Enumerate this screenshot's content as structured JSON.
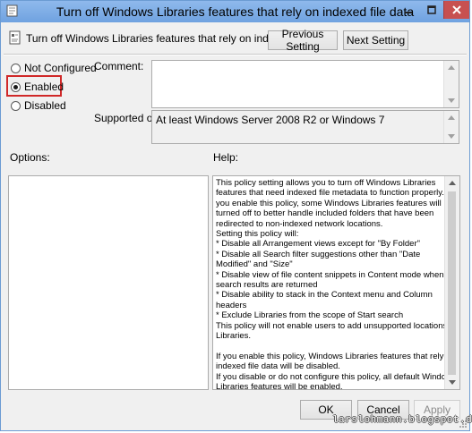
{
  "window": {
    "title": "Turn off Windows Libraries features that rely on indexed file data",
    "header_text": "Turn off Windows Libraries features that rely on indexed file data",
    "accent_title_bar": "#7aaae6",
    "accent_close_button": "#c75050"
  },
  "navigation": {
    "previous_label": "Previous Setting",
    "next_label": "Next Setting"
  },
  "state_options": {
    "not_configured": "Not Configured",
    "enabled": "Enabled",
    "disabled": "Disabled",
    "selected": "Enabled",
    "highlight_color": "#d02828"
  },
  "fields": {
    "comment_label": "Comment:",
    "comment_value": "",
    "supported_label": "Supported on:",
    "supported_value": "At least Windows Server 2008 R2 or Windows 7"
  },
  "panels": {
    "options_label": "Options:",
    "help_label": "Help:",
    "help_lines": [
      "This policy setting allows you to turn off Windows Libraries",
      "features that need indexed file metadata to function properly.  If",
      "you enable this policy, some Windows Libraries features will be",
      "turned off to better handle included folders that have been",
      "redirected to non-indexed network locations.",
      "Setting this policy will:",
      "    * Disable all Arrangement views except for \"By Folder\"",
      "    * Disable all Search filter suggestions other than \"Date",
      "Modified\" and \"Size\"",
      "    * Disable view of file content snippets in Content mode when",
      "search results are returned",
      "    * Disable ability to stack in the Context menu and Column",
      "headers",
      "    * Exclude Libraries from the scope of Start search",
      "This policy will not enable users to add unsupported locations to",
      "Libraries.",
      "",
      "If you enable this policy, Windows Libraries features that rely on",
      "indexed file data will be disabled.",
      "If you disable or do not configure this policy, all default Windows",
      "Libraries features will be enabled."
    ]
  },
  "footer": {
    "ok_label": "OK",
    "cancel_label": "Cancel",
    "apply_label": "Apply",
    "watermark": "larslohmann.blogspot.dk"
  }
}
